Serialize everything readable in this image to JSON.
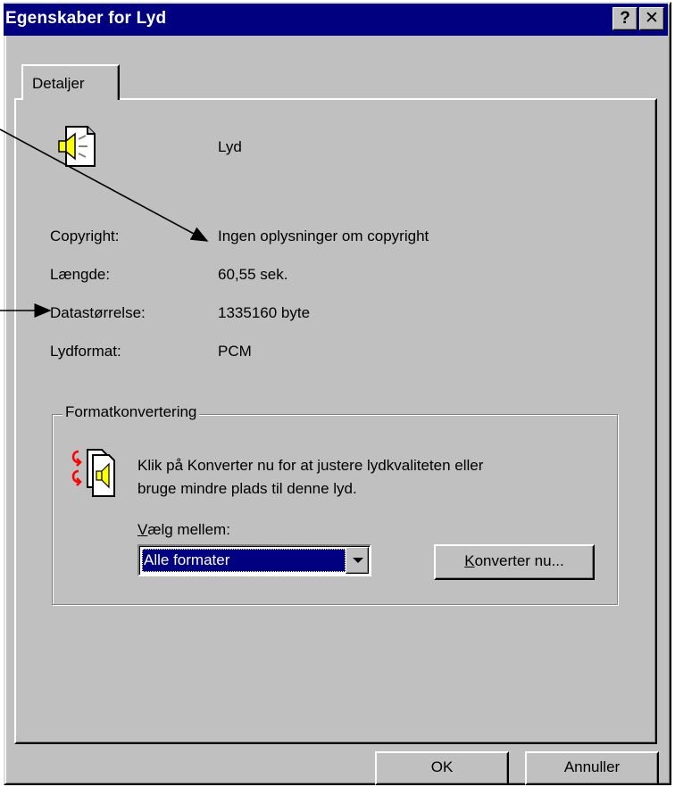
{
  "window": {
    "title": "Egenskaber for Lyd",
    "help_label": "?",
    "close_label": "✕"
  },
  "tabs": [
    {
      "label": "Detaljer",
      "selected": true
    }
  ],
  "file": {
    "name": "Lyd",
    "icon": "sound-file-icon"
  },
  "properties": {
    "copyright_label": "Copyright:",
    "copyright_value": "Ingen oplysninger om copyright",
    "length_label": "Længde:",
    "length_value": "60,55 sek.",
    "size_label": "Datastørrelse:",
    "size_value": "1335160 byte",
    "format_label": "Lydformat:",
    "format_value": "PCM"
  },
  "conversion": {
    "group_title": "Formatkonvertering",
    "icon": "convert-sound-icon",
    "description_line1": "Klik på Konverter nu for at justere lydkvaliteten eller",
    "description_line2": "bruge mindre plads til denne lyd.",
    "choose_label_accel": "V",
    "choose_label_rest": "ælg mellem:",
    "selected_option": "Alle formater",
    "convert_button_accel": "K",
    "convert_button_rest": "onverter nu..."
  },
  "buttons": {
    "ok": "OK",
    "cancel": "Annuller"
  },
  "colors": {
    "titlebar": "#000080",
    "face": "#c0c0c0",
    "selection": "#000080"
  }
}
